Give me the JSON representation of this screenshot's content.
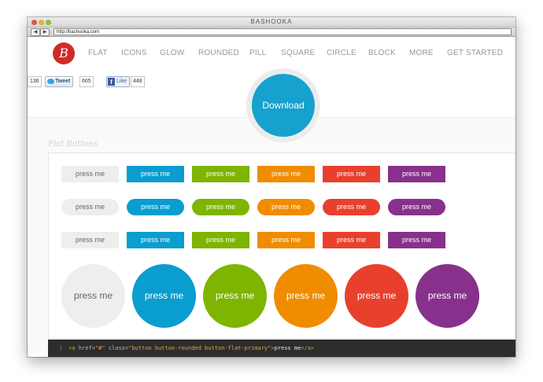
{
  "window": {
    "title": "BASHOOKA",
    "url": "http://bashooka.com"
  },
  "nav": {
    "logo": "B",
    "items": [
      "FLAT",
      "ICONS",
      "GLOW",
      "ROUNDED",
      "PILL",
      "SQUARE",
      "CIRCLE",
      "BLOCK",
      "MORE",
      "GET STARTED"
    ]
  },
  "social": {
    "share_count": "136",
    "tweet_label": "Tweet",
    "tweet_count": "665",
    "like_label": "Like",
    "like_count": "448"
  },
  "hero": {
    "download_label": "Download"
  },
  "section": {
    "title": "Flat Buttons"
  },
  "buttons": {
    "label": "press me",
    "styles": [
      "default",
      "primary",
      "action",
      "highlight",
      "caution",
      "royal"
    ],
    "colors": {
      "default": "#eeeeee",
      "primary": "#0a9dcf",
      "action": "#7db500",
      "highlight": "#f08c00",
      "caution": "#e8402c",
      "royal": "#87318c"
    }
  },
  "code": {
    "line_number": "1",
    "tag_open": "<a",
    "href_attr": "href=",
    "href_value": "\"#\"",
    "class_attr": "class=",
    "class_value": "\"button button-rounded button-flat-primary\"",
    "close_bracket": ">",
    "text": "press me",
    "tag_close": "</a>"
  }
}
